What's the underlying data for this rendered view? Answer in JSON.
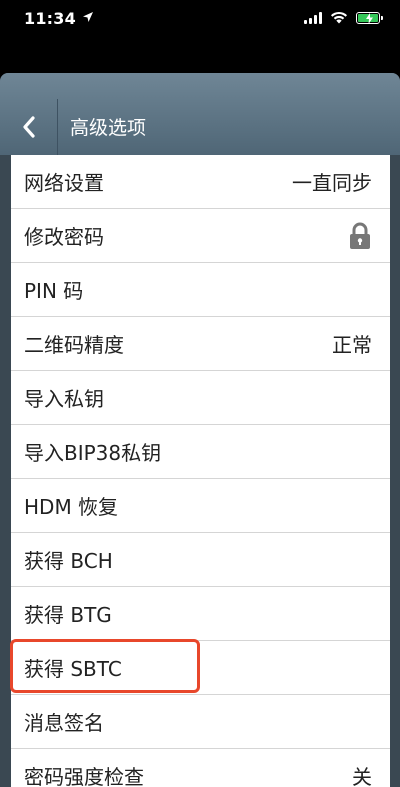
{
  "status_bar": {
    "time": "11:34"
  },
  "header": {
    "back_icon": "chevron-left-icon",
    "title": "高级选项"
  },
  "settings": [
    {
      "label": "网络设置",
      "value": "一直同步"
    },
    {
      "label": "修改密码",
      "icon": "lock-icon"
    },
    {
      "label": "PIN 码"
    },
    {
      "label": "二维码精度",
      "value": "正常"
    },
    {
      "label": "导入私钥"
    },
    {
      "label": "导入BIP38私钥"
    },
    {
      "label": "HDM 恢复"
    },
    {
      "label": "获得 BCH"
    },
    {
      "label": "获得 BTG"
    },
    {
      "label": "获得 SBTC",
      "highlighted": true
    },
    {
      "label": "消息签名"
    },
    {
      "label": "密码强度检查",
      "value": "关"
    }
  ],
  "colors": {
    "highlight": "#e8472b",
    "header": "#5f7686",
    "battery": "#35c759"
  }
}
